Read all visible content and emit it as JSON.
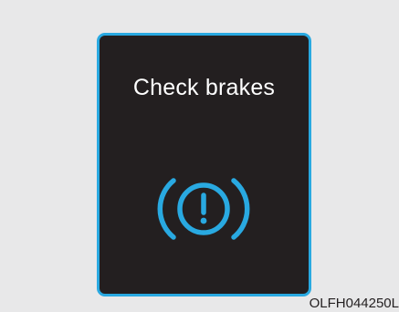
{
  "cluster": {
    "warning_message": "Check brakes",
    "warning_icon": "brake-warning-icon",
    "colors": {
      "panel_background": "#231f20",
      "panel_border": "#29a9e1",
      "icon": "#29a9e1",
      "message_text": "#ffffff"
    }
  },
  "figure": {
    "code": "OLFH044250L"
  }
}
